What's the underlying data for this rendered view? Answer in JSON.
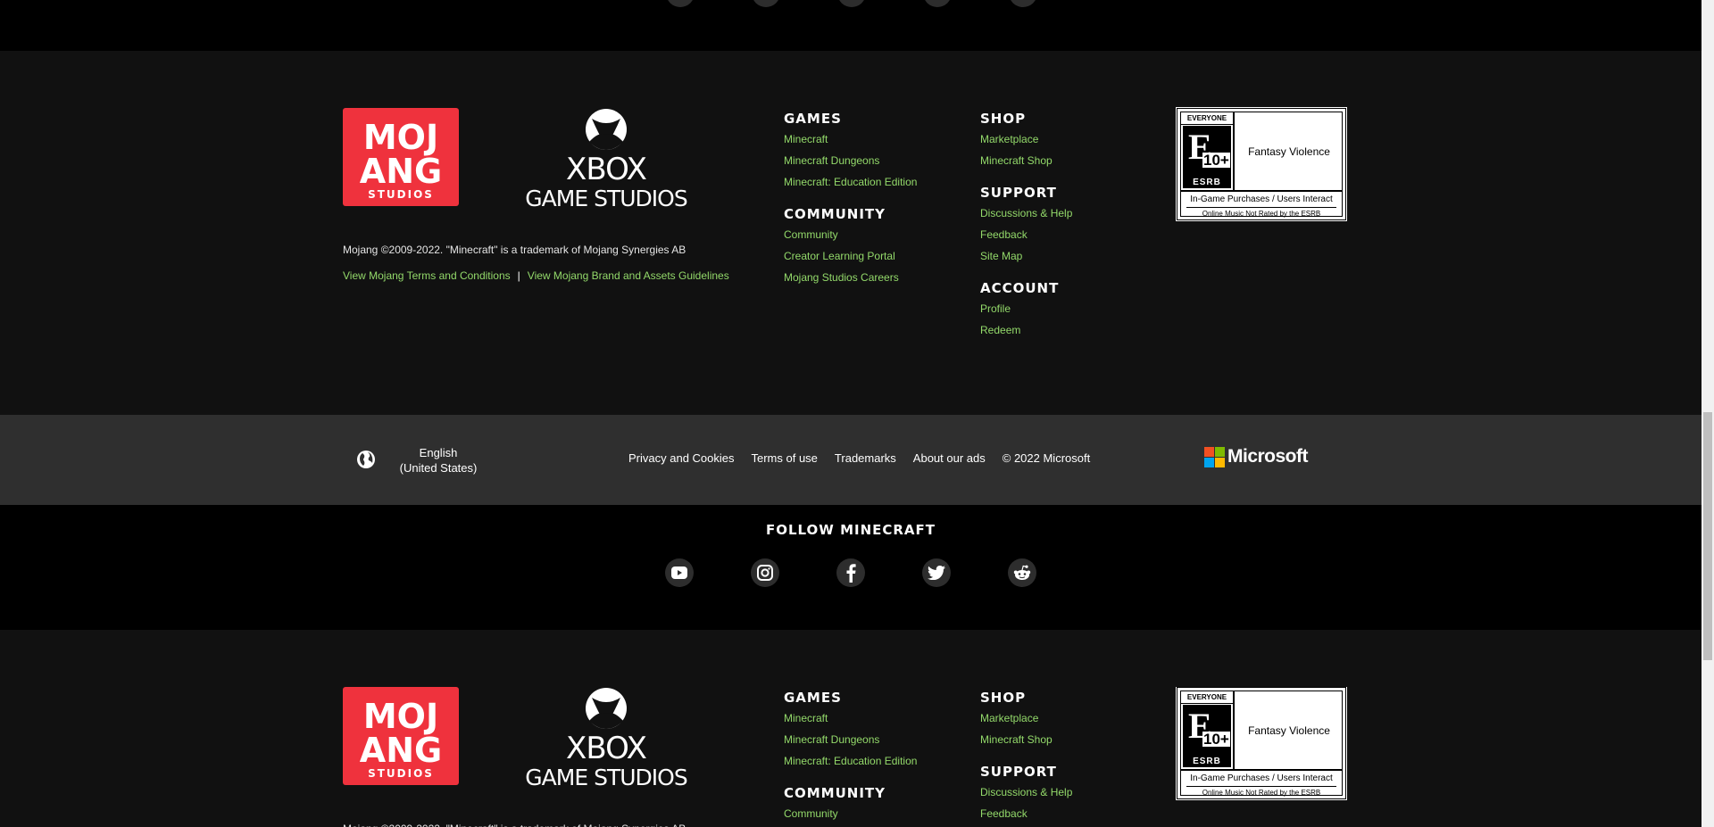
{
  "legal": {
    "copyright": "Mojang ©2009-2022. \"Minecraft\" is a trademark of Mojang Synergies AB",
    "terms_link": "View Mojang Terms and Conditions",
    "separator": "|",
    "brand_link": "View Mojang Brand and Assets Guidelines"
  },
  "logos": {
    "mojang": [
      "MOJ",
      "ANG",
      "STUDIOS"
    ],
    "xbox": [
      "XBOX",
      "GAME STUDIOS"
    ]
  },
  "nav": {
    "games": {
      "title": "GAMES",
      "items": [
        "Minecraft",
        "Minecraft Dungeons",
        "Minecraft: Education Edition"
      ]
    },
    "community": {
      "title": "COMMUNITY",
      "items": [
        "Community",
        "Creator Learning Portal",
        "Mojang Studios Careers"
      ]
    },
    "shop": {
      "title": "SHOP",
      "items": [
        "Marketplace",
        "Minecraft Shop"
      ]
    },
    "support": {
      "title": "SUPPORT",
      "items": [
        "Discussions & Help",
        "Feedback",
        "Site Map"
      ]
    },
    "account": {
      "title": "ACCOUNT",
      "items": [
        "Profile",
        "Redeem"
      ]
    }
  },
  "esrb": {
    "everyone": "EVERYONE 10+",
    "letter": "E",
    "age": "10+",
    "label": "ESRB",
    "descriptor": "Fantasy Violence",
    "interactive": "In-Game Purchases / Users Interact",
    "music": "Online Music Not Rated by the ESRB"
  },
  "ms_bar": {
    "language": "English (United States)",
    "links": [
      "Privacy and Cookies",
      "Terms of use",
      "Trademarks",
      "About our ads"
    ],
    "copyright": "© 2022 Microsoft",
    "logo_text": "Microsoft",
    "logo_colors": [
      "#f25022",
      "#7fba00",
      "#00a4ef",
      "#ffb900"
    ]
  },
  "follow": {
    "title": "FOLLOW MINECRAFT",
    "icons": [
      "youtube-icon",
      "instagram-icon",
      "facebook-icon",
      "twitter-icon",
      "reddit-icon"
    ]
  },
  "colors": {
    "link": "#93d96a",
    "mojang_red": "#ef323d",
    "background": "#111111",
    "ms_bar": "#2f2f2f"
  }
}
